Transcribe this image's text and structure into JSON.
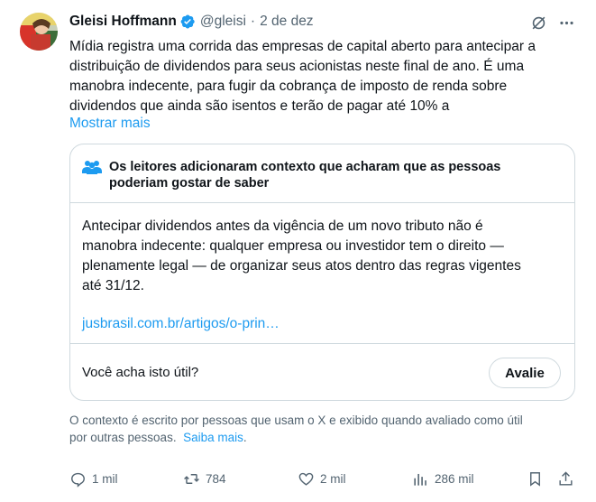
{
  "author": {
    "name": "Gleisi Hoffmann",
    "handle": "@gleisi",
    "separator": "·",
    "date": "2 de dez"
  },
  "header_icons": [
    "grok-icon",
    "more-icon"
  ],
  "tweet": {
    "lines": [
      "Mídia registra uma corrida das empresas de capital aberto para antecipar a",
      "distribuição de dividendos para seus acionistas neste final de ano. É uma",
      "manobra indecente, para fugir da cobrança de imposto de renda sobre",
      "dividendos que ainda são isentos e terão de pagar até 10% a"
    ],
    "show_more": "Mostrar mais"
  },
  "community_note": {
    "title_lines": [
      "Os leitores adicionaram contexto que acharam que as pessoas",
      "poderiam gostar de saber"
    ],
    "body_lines": [
      "Antecipar dividendos antes da vigência de um novo tributo não é",
      "manobra indecente: qualquer empresa ou investidor tem o direito —",
      "plenamente legal — de organizar seus atos dentro das regras vigentes",
      "até 31/12."
    ],
    "link": "jusbrasil.com.br/artigos/o-prin…",
    "useful_question": "Você acha isto útil?",
    "rate_button": "Avalie"
  },
  "disclaimer": {
    "line1": "O contexto é escrito por pessoas que usam o X e exibido quando avaliado como útil",
    "line2_prefix": "por outras pessoas.",
    "learn_more": "Saiba mais",
    "line2_suffix": "."
  },
  "actions": {
    "replies": "1 mil",
    "reposts": "784",
    "likes": "2 mil",
    "views": "286 mil"
  },
  "colors": {
    "text": "#0f1419",
    "secondary": "#536471",
    "link": "#1d9bf0",
    "border": "#cfd9de",
    "verified": "#1d9bf0"
  }
}
